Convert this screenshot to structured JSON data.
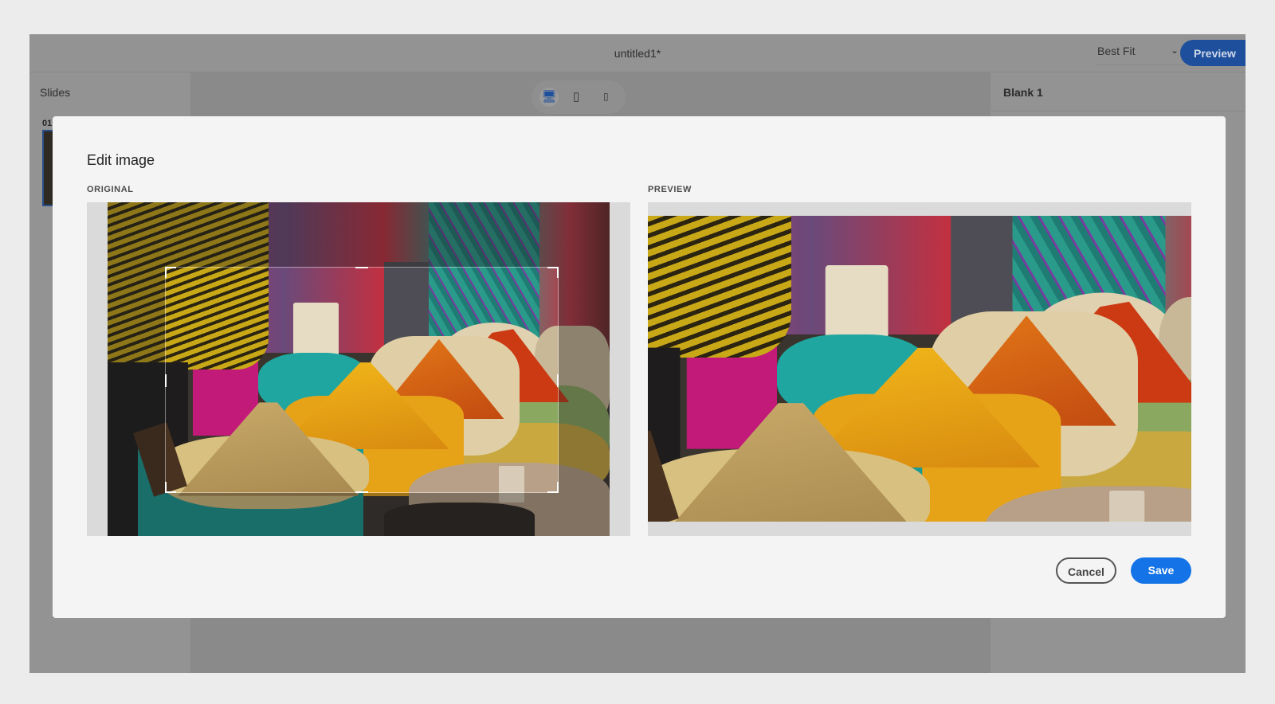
{
  "header": {
    "doc_title": "untitled1*",
    "zoom_select": "Best Fit",
    "preview_button": "Preview"
  },
  "slides_panel": {
    "title": "Slides",
    "slide_number": "01"
  },
  "device_toggle": {
    "icons": [
      "desktop-icon",
      "tablet-icon",
      "mobile-icon"
    ],
    "selected": "desktop"
  },
  "properties_panel": {
    "title": "Blank 1"
  },
  "dialog": {
    "title": "Edit image",
    "original_label": "ORIGINAL",
    "preview_label": "PREVIEW",
    "cancel": "Cancel",
    "save": "Save"
  },
  "colors": {
    "accent": "#1473e6",
    "preview_btn": "#1d4f9c"
  }
}
